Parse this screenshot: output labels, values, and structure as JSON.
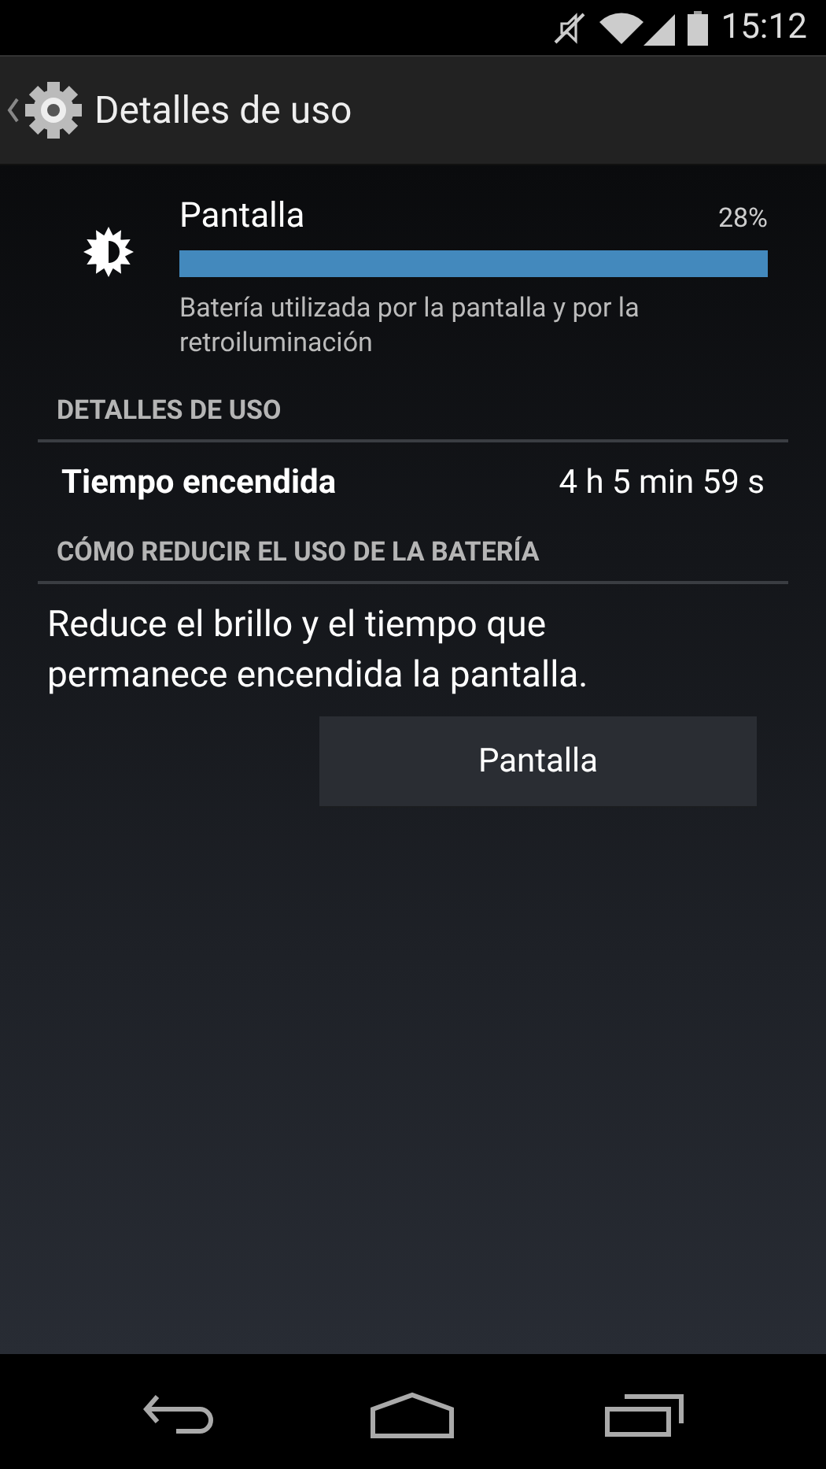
{
  "status_bar": {
    "time": "15:12"
  },
  "action_bar": {
    "title": "Detalles de uso"
  },
  "usage_item": {
    "title": "Pantalla",
    "percent": "28%",
    "description": "Batería utilizada por la pantalla y por la retroiluminación"
  },
  "sections": [
    {
      "header": "DETALLES DE USO",
      "kind": "detail",
      "label": "Tiempo encendida",
      "value": "4 h 5 min 59 s"
    },
    {
      "header": "CÓMO REDUCIR EL USO DE LA BATERÍA",
      "kind": "tip",
      "text": "Reduce el brillo y el tiempo que permanece encendida la pantalla.",
      "button": "Pantalla"
    }
  ]
}
